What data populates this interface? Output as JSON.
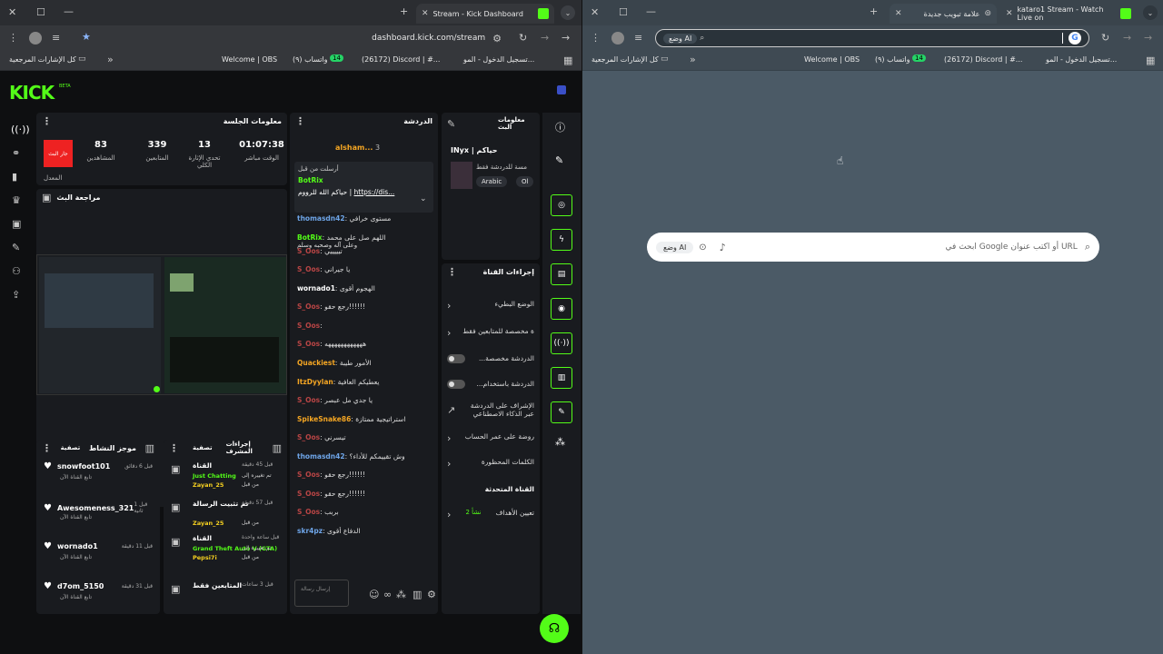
{
  "left": {
    "tabs": [
      {
        "title": "Stream - Kick Dashboard"
      }
    ],
    "omnibox": {
      "url": "dashboard.kick.com/stream"
    },
    "bookmarks": {
      "all": "كل الإشارات المرجعية",
      "items": [
        "Welcome | OBS",
        "(٩) واتساب",
        "(26172) Discord | #...",
        "تسجيل الدخول - المو..."
      ],
      "whatsapp_count": "14"
    },
    "brand": {
      "logo": "KICK",
      "beta": "BETA"
    },
    "session": {
      "title": "معلومات الجلسة",
      "live_badge": "جار البث",
      "stats": [
        {
          "value": "01:07:38",
          "label": "الوقت مباشر"
        },
        {
          "value": "13",
          "label": "تحدي الإثارة الكلي"
        },
        {
          "value": "339",
          "label": "المتابعين"
        },
        {
          "value": "83",
          "label": "المشاهدين"
        }
      ],
      "extra": "المعدل"
    },
    "preview": {
      "title": "مراجعة البث"
    },
    "chat": {
      "title": "الدردشة",
      "top_user": "alsham...",
      "top_count": "3",
      "pinned": {
        "header": "أرسلت من قبل",
        "user": "BotRix",
        "text": "حياكم الله للرووم |",
        "link": "https://dis..."
      },
      "messages": [
        {
          "user": "thomasdn42",
          "text": "مستوى خرافي",
          "color": "blue"
        },
        {
          "user": "BotRix",
          "text": "اللهم صل على محمد",
          "text2": "وعلى آله وصحبه وسلم",
          "color": "green"
        },
        {
          "user": "S_Oos",
          "text": "تيييييي",
          "color": "red"
        },
        {
          "user": "S_Oos",
          "text": "يا جيراني",
          "color": "red"
        },
        {
          "user": "wornado1",
          "text": "الهجوم أقوى",
          "color": "white"
        },
        {
          "user": "S_Oos",
          "text": "رجع حقو!!!!!!",
          "color": "red"
        },
        {
          "user": "S_Oos",
          "text": "",
          "color": "red"
        },
        {
          "user": "S_Oos",
          "text": "ههههههههههههه",
          "color": "red"
        },
        {
          "user": "Quackiest",
          "text": "الأمور طيبة",
          "color": "yellow"
        },
        {
          "user": "ItzDyylan",
          "text": "يعطيكم العافية",
          "color": "yellow"
        },
        {
          "user": "S_Oos",
          "text": "يا جدي مل عبصر",
          "color": "red"
        },
        {
          "user": "SpikeSnake86",
          "text": "استراتيجية ممتازة",
          "color": "yellow"
        },
        {
          "user": "S_Oos",
          "text": "تيسرني",
          "color": "red"
        },
        {
          "user": "thomasdn42",
          "text": "وش تقييمكم للأداء؟",
          "color": "blue"
        },
        {
          "user": "S_Oos",
          "text": "رجع حقو!!!!!!",
          "color": "red"
        },
        {
          "user": "S_Oos",
          "text": "رجع حقو!!!!!!",
          "color": "red"
        },
        {
          "user": "S_Oos",
          "text": "بربب",
          "color": "red"
        },
        {
          "user": "skr4pz",
          "text": "الدفاع أقوى",
          "color": "blue"
        }
      ],
      "input_placeholder": "إرسال رسالة"
    },
    "stream_info": {
      "title": "معلومات البث",
      "channel": "INyx | حياكم",
      "desc": "مسة للدردشة فقط",
      "tags": [
        "Arabic",
        "Ol"
      ]
    },
    "channel_actions": {
      "title": "إجراءات القناة",
      "items": [
        {
          "label": "الوضع البطيء",
          "type": "arrow"
        },
        {
          "label": "ة مخصصة للمتابعين فقط",
          "type": "arrow"
        },
        {
          "label": "...الدردشة مخصصة",
          "type": "toggle"
        },
        {
          "label": "...الدردشة باستخدام",
          "type": "toggle"
        },
        {
          "label": "الإشراف على الدردشة عبر الذكاء الاصطناعي",
          "type": "ext"
        },
        {
          "label": "روضة على عمر الحساب",
          "type": "arrow"
        },
        {
          "label": "الكلمات المحظورة",
          "type": "arrow"
        }
      ],
      "section": "القناة المتحدثة",
      "goal_label": "تعيين الأهداف",
      "goal_status": "نشأ 2"
    },
    "activity": {
      "title": "موجز النشاط",
      "filter": "تصفية",
      "items": [
        {
          "user": "snowfoot101",
          "time": "قبل 6 دقائق",
          "sub": "تابع القناة الآن"
        },
        {
          "user": "Awesomeness_321",
          "time": "قبل 1 ثانية",
          "sub": "تابع القناة الآن"
        },
        {
          "user": "wornado1",
          "time": "قبل 11 دقيقة",
          "sub": "تابع القناة الآن"
        },
        {
          "user": "d7om_5150",
          "time": "قبل 31 دقيقة",
          "sub": "تابع القناة الآن"
        }
      ]
    },
    "mod_actions": {
      "title": "إجراءات المشرف",
      "filter": "تصفية",
      "items": [
        {
          "title": "القناة",
          "time": "قبل 45 دقيقة",
          "desc": "تم تغييره إلى",
          "value": "Just Chatting",
          "by": "Zayan_25",
          "byprefix": "من قبل"
        },
        {
          "title": "تم تثبيت الرسالة",
          "time": "قبل 57 دقيقة",
          "desc": "",
          "value": "",
          "by": "Zayan_25",
          "byprefix": "من قبل"
        },
        {
          "title": "القناة",
          "time": "قبل ساعة واحدة",
          "desc": "تم تغييره إلى",
          "value": "Grand Theft Auto V (GTA)",
          "by": "Pepsi7i",
          "byprefix": "من قبل"
        },
        {
          "title": "المتابعين فقط",
          "time": "قبل 3 ساعات",
          "desc": "",
          "value": "",
          "by": "",
          "byprefix": ""
        }
      ]
    }
  },
  "right": {
    "tabs": [
      {
        "title": "علامة تبويب جديدة"
      },
      {
        "title": "kataro1 Stream - Watch Live on"
      }
    ],
    "omnibox": {
      "ai_mode": "وضع AI"
    },
    "bookmarks": {
      "all": "كل الإشارات المرجعية",
      "items": [
        "Welcome | OBS",
        "(٩) واتساب",
        "(26172) Discord | #...",
        "تسجيل الدخول - المو..."
      ],
      "whatsapp_count": "14"
    },
    "search": {
      "placeholder": "ابحث في Google أو اكتب عنوان URL",
      "ai_mode": "وضع AI"
    }
  },
  "colors": {
    "kick_green": "#53fc18",
    "dash_bg": "#0e0f11",
    "panel_bg": "#191b1f",
    "new_tab_bg": "#4b5a66"
  }
}
